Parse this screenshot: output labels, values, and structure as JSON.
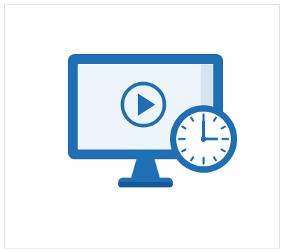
{
  "tile": {
    "illustration": {
      "icons": [
        "monitor-icon",
        "play-icon",
        "clock-icon"
      ],
      "colors": {
        "primary_blue": "#1f6fb5",
        "dark_blue": "#155a96",
        "screen_light": "#eef4fb",
        "screen_shade": "#d7e3f1",
        "play_blue": "#1f6fb5",
        "clock_face": "#ffffff",
        "background": "#ffffff",
        "border": "#e1e4e8"
      }
    }
  }
}
